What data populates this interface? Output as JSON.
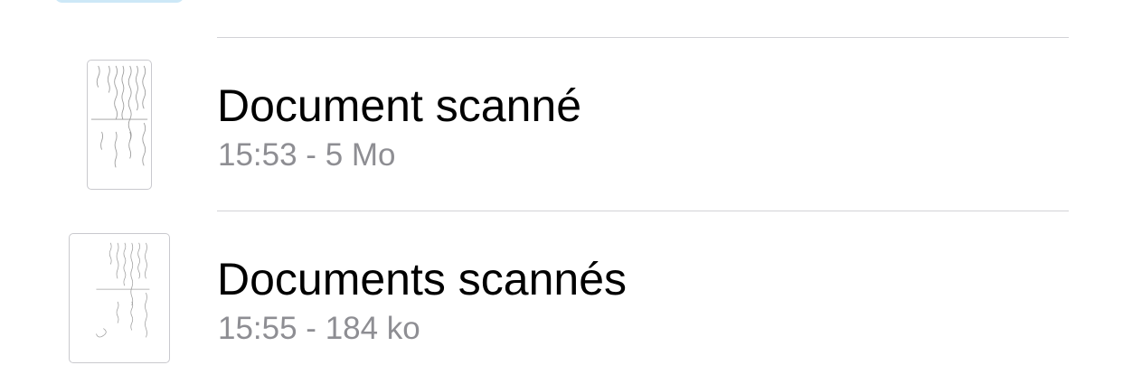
{
  "colors": {
    "title": "#000000",
    "subtitle": "#8e8e93",
    "separator": "#d2d2d6",
    "top_fragment": "#cde8f7"
  },
  "documents": [
    {
      "title": "Document scanné",
      "subtitle": "15:53 - 5 Mo",
      "icon": "scanned-document-thumbnail"
    },
    {
      "title": "Documents scannés",
      "subtitle": "15:55 - 184 ko",
      "icon": "scanned-document-thumbnail"
    }
  ]
}
